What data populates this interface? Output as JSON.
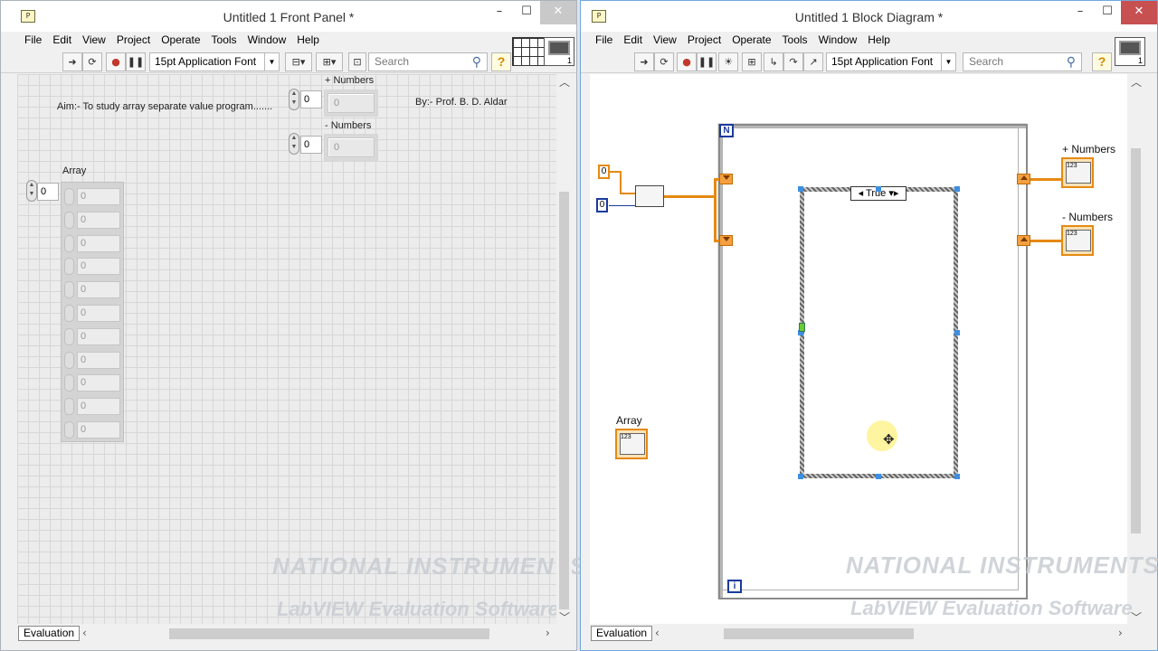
{
  "front_panel": {
    "title": "Untitled 1 Front Panel *",
    "menus": [
      "File",
      "Edit",
      "View",
      "Project",
      "Operate",
      "Tools",
      "Window",
      "Help"
    ],
    "font": "15pt Application Font",
    "search_placeholder": "Search",
    "aim_text": "Aim:- To study array separate value program.......",
    "by_text": "By:- Prof. B. D. Aldar",
    "plus_label": "+ Numbers",
    "minus_label": "- Numbers",
    "array_label": "Array",
    "plus_index": "0",
    "minus_index": "0",
    "array_index": "0",
    "plus_value": "0",
    "minus_value": "0",
    "array_values": [
      "0",
      "0",
      "0",
      "0",
      "0",
      "0",
      "0",
      "0",
      "0",
      "0",
      "0"
    ],
    "status": "Evaluation",
    "conpane_n": "1",
    "watermark_brand": "NATIONAL INSTRUMENTS",
    "watermark_product": "LabVIEW Evaluation Software"
  },
  "block_diagram": {
    "title": "Untitled 1 Block Diagram *",
    "menus": [
      "File",
      "Edit",
      "View",
      "Project",
      "Operate",
      "Tools",
      "Window",
      "Help"
    ],
    "font": "15pt Application Font",
    "search_placeholder": "Search",
    "count_terminal": "N",
    "iteration_terminal": "i",
    "case_selector": "True",
    "const_dim": "0",
    "const_elem": "0",
    "plus_label": "+ Numbers",
    "minus_label": "- Numbers",
    "array_label": "Array",
    "terminal_type": "123",
    "status": "Evaluation",
    "conpane_n": "1",
    "watermark_brand": "NATIONAL INSTRUMENTS",
    "watermark_product": "LabVIEW Evaluation Software"
  },
  "colors": {
    "wire_array": "#e58a12",
    "wire_int": "#1a3a9c",
    "selection": "#3d8fe0",
    "bd_border": "#6fa8dc"
  }
}
